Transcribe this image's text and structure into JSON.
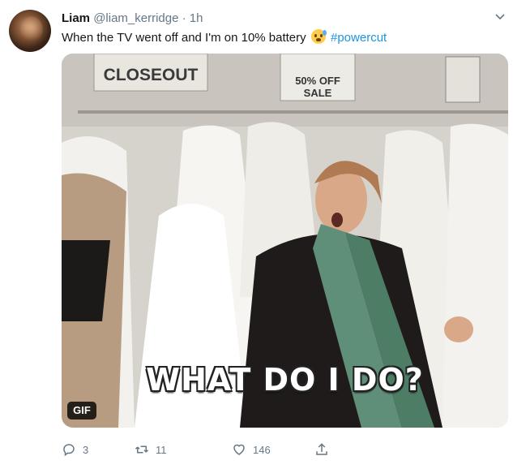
{
  "tweet": {
    "display_name": "Liam",
    "handle": "@liam_kerridge",
    "separator": "·",
    "time": "1h",
    "text_before": "When the TV went off and I'm on 10% battery",
    "hashtag": "#powercut"
  },
  "media": {
    "caption": "WHAT DO I DO?",
    "badge": "GIF",
    "sign_closeout": "CLOSEOUT",
    "sign_sale_line1": "50% OFF",
    "sign_sale_line2": "SALE"
  },
  "actions": {
    "reply_count": "3",
    "retweet_count": "11",
    "like_count": "146"
  },
  "icons": {
    "reply": "reply-icon",
    "retweet": "retweet-icon",
    "like": "heart-icon",
    "share": "share-icon",
    "caret": "chevron-down-icon",
    "emoji": "anxious-face-emoji"
  },
  "colors": {
    "hashtag": "#1b95e0",
    "meta": "#657786",
    "text": "#14171a"
  }
}
